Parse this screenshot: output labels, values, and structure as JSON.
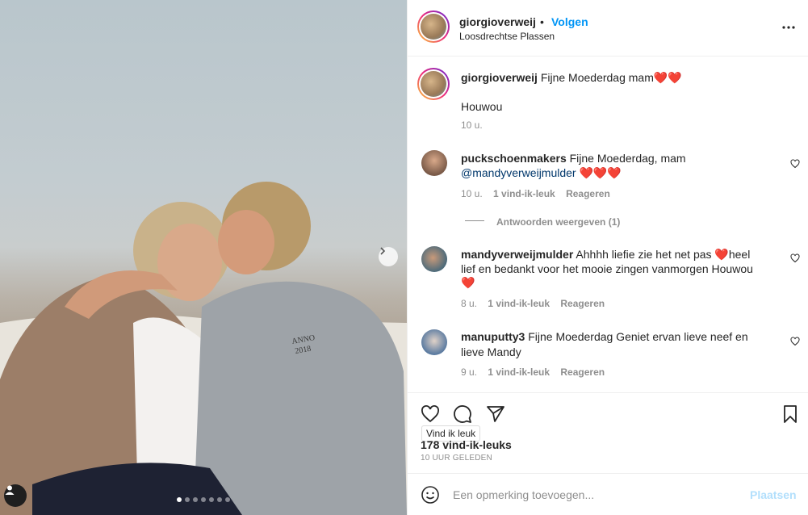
{
  "post": {
    "username": "giorgioverweij",
    "separator": "•",
    "follow_label": "Volgen",
    "location": "Loosdrechtse Plassen"
  },
  "caption": {
    "username": "giorgioverweij",
    "text": "Fijne Moederdag mam❤️❤️",
    "line2": "Houwou",
    "time": "10 u."
  },
  "comments": [
    {
      "username": "puckschoenmakers",
      "text_before": "Fijne Moederdag, mam",
      "mention": "@mandyverweijmulder",
      "text_after": "❤️❤️❤️",
      "time": "10 u.",
      "likes": "1 vind-ik-leuk",
      "reply": "Reageren",
      "replies_label": "Antwoorden weergeven (1)"
    },
    {
      "username": "mandyverweijmulder",
      "line1": "Ahhhh liefie zie het net pas ❤️heel",
      "line2": "lief en bedankt voor het mooie zingen vanmorgen Houwou",
      "line3": "❤️",
      "time": "8 u.",
      "likes": "1 vind-ik-leuk",
      "reply": "Reageren"
    },
    {
      "username": "manuputty3",
      "line1": "Fijne Moederdag Geniet ervan lieve neef en",
      "line2": "lieve Mandy",
      "time": "9 u.",
      "likes": "1 vind-ik-leuk",
      "reply": "Reageren"
    }
  ],
  "actions": {
    "tooltip": "Vind ik leuk",
    "likes": "178 vind-ik-leuks",
    "timestamp": "10 UUR GELEDEN"
  },
  "comment_input": {
    "placeholder": "Een opmerking toevoegen...",
    "post_label": "Plaatsen"
  },
  "photo": {
    "hoodie_text_1": "ANNO",
    "hoodie_text_2": "2018",
    "carousel_count": 7,
    "carousel_active": 1
  },
  "icons": [
    "more-icon",
    "heart-icon",
    "comment-icon",
    "share-icon",
    "bookmark-icon",
    "emoji-icon",
    "chevron-right-icon",
    "user-tag-icon"
  ],
  "colors": {
    "link": "#0095f6",
    "post_disabled": "#b2dffc",
    "mention": "#00376b"
  }
}
